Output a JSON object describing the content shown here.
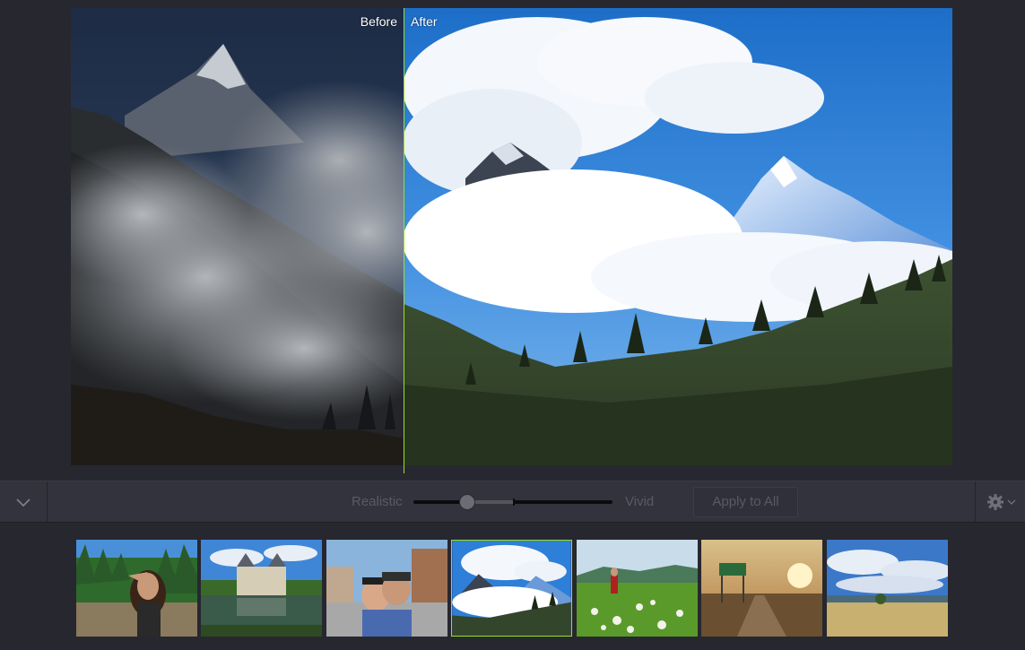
{
  "compare": {
    "before_label": "Before",
    "after_label": "After",
    "accent_color": "#9be01f"
  },
  "controls": {
    "collapse_icon": "chevron-down-icon",
    "left_label": "Realistic",
    "right_label": "Vivid",
    "strength": 0.27,
    "apply_label": "Apply to All",
    "settings_icon": "gear-icon"
  },
  "filmstrip": {
    "thumbnails": [
      {
        "subject": "woman-portrait",
        "selected": false
      },
      {
        "subject": "chateau-by-lake",
        "selected": false
      },
      {
        "subject": "couple-selfie",
        "selected": false
      },
      {
        "subject": "mountain-clouds",
        "selected": true
      },
      {
        "subject": "meadow-hiker",
        "selected": false
      },
      {
        "subject": "road-sign-sunset",
        "selected": false
      },
      {
        "subject": "grassland-sky",
        "selected": false
      }
    ]
  }
}
